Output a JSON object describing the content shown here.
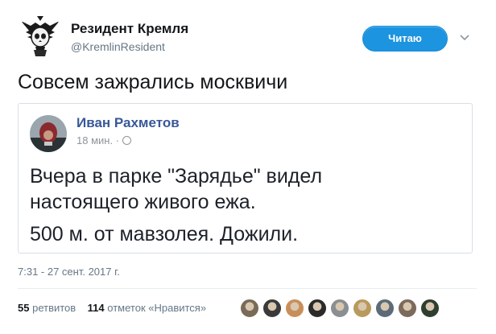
{
  "profile": {
    "name": "Резидент Кремля",
    "handle": "@KremlinResident",
    "follow_label": "Читаю",
    "avatar_icon": "skull-eagle-emblem-icon"
  },
  "tweet": {
    "text": "Совсем зажрались москвичи",
    "date": "7:31 - 27 сент. 2017 г."
  },
  "embedded_post": {
    "author": "Иван Рахметов",
    "time": "18 мин.",
    "line1": "Вчера в парке \"Зарядье\" видел",
    "line2": "настоящего живого ежа.",
    "line3": "500 м. от мавзолея. Дожили."
  },
  "stats": {
    "retweets_count": "55",
    "retweets_label": "ретвитов",
    "likes_count": "114",
    "likes_label": "отметок «Нравится»"
  },
  "liker_avatars": [
    "#7a6a58",
    "#3b3a3a",
    "#c98f5a",
    "#2b2b2b",
    "#8a8f93",
    "#b89a5c",
    "#5b6b78",
    "#7c6a5b",
    "#2f3f2f"
  ],
  "colors": {
    "accent": "#1c94e0",
    "fb_link": "#385898"
  }
}
